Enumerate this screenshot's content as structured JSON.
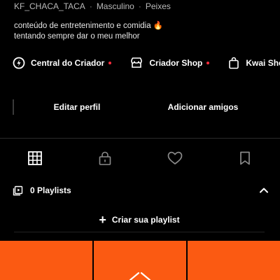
{
  "profile": {
    "username": "KF_CHACA_TACA",
    "gender": "Masculino",
    "sign": "Peixes",
    "separator": "·",
    "bio_line1": "conteúdo de entretenimento e comidia",
    "bio_emoji": "🔥",
    "bio_line2": "tentando sempre dar o meu melhor"
  },
  "creator_links": [
    {
      "label": "Central do Criador",
      "icon": "creator-center-icon"
    },
    {
      "label": "Criador Shop",
      "icon": "shop-icon"
    },
    {
      "label": "Kwai Sho",
      "icon": "shopping-bag-icon"
    }
  ],
  "actions": {
    "edit_profile": "Editar perfil",
    "add_friends": "Adicionar amigos"
  },
  "tabs": [
    {
      "name": "grid",
      "icon": "grid-icon"
    },
    {
      "name": "private",
      "icon": "lock-icon"
    },
    {
      "name": "likes",
      "icon": "heart-icon"
    },
    {
      "name": "saved",
      "icon": "bookmark-icon"
    }
  ],
  "playlists": {
    "label": "0 Playlists",
    "icon": "playlist-icon",
    "create_label": "Criar sua playlist",
    "create_icon": "plus-icon"
  },
  "colors": {
    "background": "#000000",
    "accent_orange": "#fb5a12",
    "notification_dot": "#ff2d3d"
  }
}
